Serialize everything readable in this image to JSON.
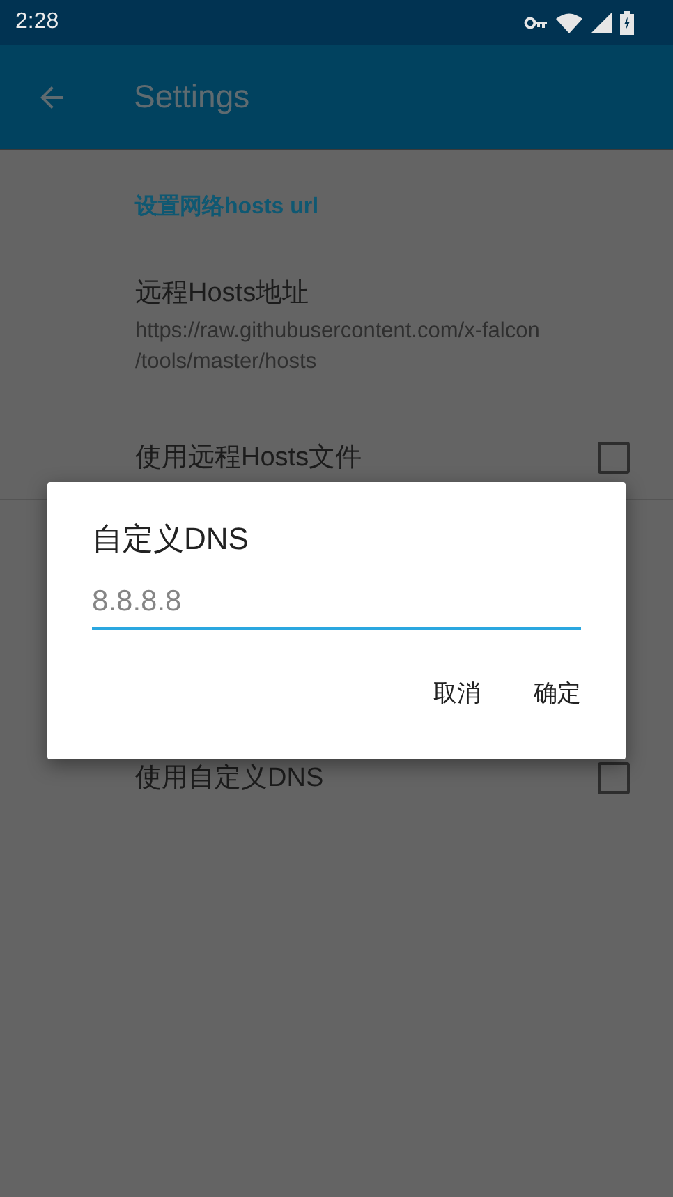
{
  "status_bar": {
    "time": "2:28"
  },
  "app_bar": {
    "title": "Settings"
  },
  "sections": [
    {
      "title": "设置网络hosts url",
      "items": [
        {
          "kind": "text",
          "title": "远程Hosts地址",
          "summary": "https://raw.githubusercontent.com/x-falcon\n/tools/master/hosts"
        },
        {
          "kind": "checkbox",
          "title": "使用远程Hosts文件",
          "checked": false
        }
      ]
    },
    {
      "items": [
        {
          "kind": "checkbox",
          "title": "使用自定义DNS",
          "checked": false
        }
      ]
    }
  ],
  "dialog": {
    "title": "自定义DNS",
    "field": {
      "placeholder": "8.8.8.8"
    },
    "buttons": [
      "取消",
      "确定"
    ]
  }
}
